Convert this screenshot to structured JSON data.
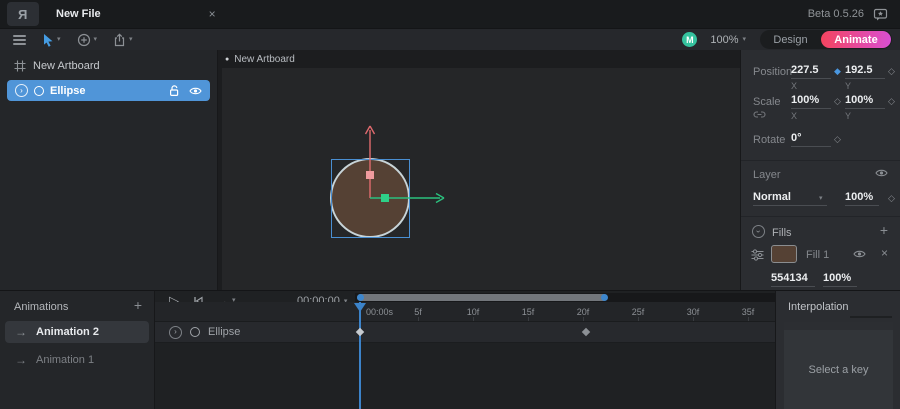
{
  "titlebar": {
    "logo_glyph": "R",
    "tab_title": "New File",
    "beta_label": "Beta 0.5.26"
  },
  "toolbar": {
    "zoom_level": "100%",
    "avatar_initial": "M",
    "design_label": "Design",
    "animate_label": "Animate"
  },
  "hierarchy": {
    "artboard_label": "New Artboard",
    "ellipse_label": "Ellipse"
  },
  "canvas": {
    "artboard_title": "New Artboard"
  },
  "inspector": {
    "position_label": "Position",
    "position_x": "227.5",
    "position_y": "192.5",
    "scale_label": "Scale",
    "scale_x": "100%",
    "scale_y": "100%",
    "rotate_label": "Rotate",
    "rotate_value": "0°",
    "axis_x": "X",
    "axis_y": "Y",
    "layer_label": "Layer",
    "blend_mode": "Normal",
    "layer_opacity": "100%",
    "fills_label": "Fills",
    "fill_name": "Fill 1",
    "fill_hex": "554134",
    "fill_opacity": "100%"
  },
  "animations": {
    "header": "Animations",
    "items": [
      {
        "label": "Animation 2",
        "selected": true
      },
      {
        "label": "Animation 1",
        "selected": false
      }
    ]
  },
  "timeline": {
    "current_time": "00:00:00",
    "ticks": [
      "00:00s",
      "5f",
      "10f",
      "15f",
      "20f",
      "25f",
      "30f",
      "35f"
    ],
    "row_label": "Ellipse",
    "keyframes": [
      "0s",
      "20f"
    ]
  },
  "interpolation": {
    "header": "Interpolation",
    "empty_message": "Select a key"
  },
  "colors": {
    "accent_blue": "#4a97e0",
    "selection_blue": "#5095d8",
    "playhead_blue": "#3c83c9",
    "fill_brown": "#554134",
    "avatar_green": "#35c29e",
    "gizmo_red": "#e06a6e",
    "gizmo_green": "#2bc07e",
    "animate_gradient_start": "#f4445f",
    "animate_gradient_end": "#d94fd2"
  },
  "icons": {
    "close": "×",
    "plus": "+",
    "chevron_down": "▾",
    "chevron_right": "›",
    "arrow_right": "→",
    "play": "▷",
    "diamond_filled": "◆",
    "diamond_hollow": "◇",
    "bullet": "●"
  }
}
